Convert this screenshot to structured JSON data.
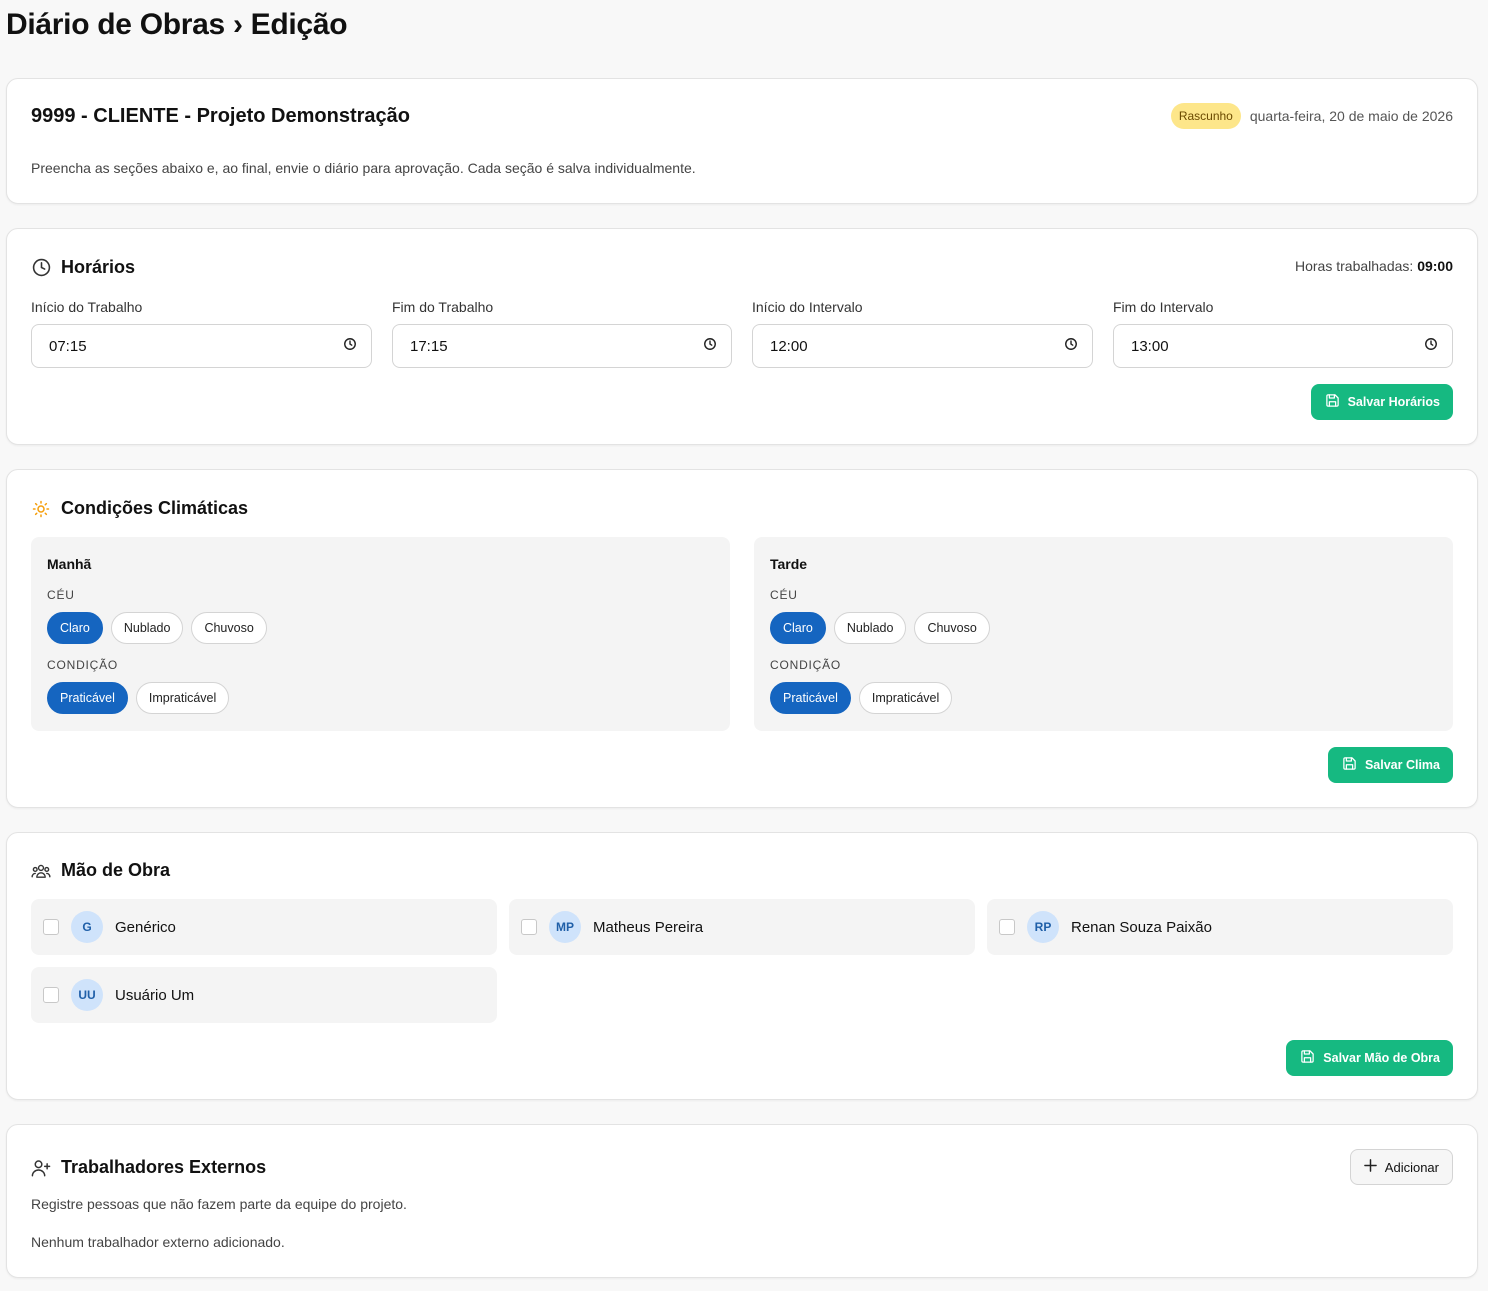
{
  "page": {
    "title": "Diário de Obras › Edição"
  },
  "project": {
    "title": "9999 - CLIENTE - Projeto Demonstração",
    "status_badge": "Rascunho",
    "date": "quarta-feira, 20 de maio de 2026",
    "description": "Preencha as seções abaixo e, ao final, envie o diário para aprovação. Cada seção é salva individualmente."
  },
  "horarios": {
    "title": "Horários",
    "total_label": "Horas trabalhadas:",
    "total_value": "09:00",
    "fields": [
      {
        "label": "Início do Trabalho",
        "value": "07:15"
      },
      {
        "label": "Fim do Trabalho",
        "value": "17:15"
      },
      {
        "label": "Início do Intervalo",
        "value": "12:00"
      },
      {
        "label": "Fim do Intervalo",
        "value": "13:00"
      }
    ],
    "save_label": "Salvar Horários"
  },
  "clima": {
    "title": "Condições Climáticas",
    "panels": [
      {
        "title": "Manhã",
        "sky_label": "CÉU",
        "sky_options": [
          "Claro",
          "Nublado",
          "Chuvoso"
        ],
        "sky_selected": "Claro",
        "cond_label": "CONDIÇÃO",
        "cond_options": [
          "Praticável",
          "Impraticável"
        ],
        "cond_selected": "Praticável"
      },
      {
        "title": "Tarde",
        "sky_label": "CÉU",
        "sky_options": [
          "Claro",
          "Nublado",
          "Chuvoso"
        ],
        "sky_selected": "Claro",
        "cond_label": "CONDIÇÃO",
        "cond_options": [
          "Praticável",
          "Impraticável"
        ],
        "cond_selected": "Praticável"
      }
    ],
    "save_label": "Salvar Clima"
  },
  "mao_de_obra": {
    "title": "Mão de Obra",
    "workers": [
      {
        "initials": "G",
        "name": "Genérico",
        "checked": false
      },
      {
        "initials": "MP",
        "name": "Matheus Pereira",
        "checked": false
      },
      {
        "initials": "RP",
        "name": "Renan Souza Paixão",
        "checked": false
      },
      {
        "initials": "UU",
        "name": "Usuário Um",
        "checked": false
      }
    ],
    "save_label": "Salvar Mão de Obra"
  },
  "externos": {
    "title": "Trabalhadores Externos",
    "add_label": "Adicionar",
    "description": "Registre pessoas que não fazem parte da equipe do projeto.",
    "empty_text": "Nenhum trabalhador externo adicionado."
  },
  "colors": {
    "accent_blue": "#1565c0",
    "save_green": "#16b981",
    "badge_yellow": "#fde68a",
    "avatar_bg": "#cfe3fb"
  }
}
